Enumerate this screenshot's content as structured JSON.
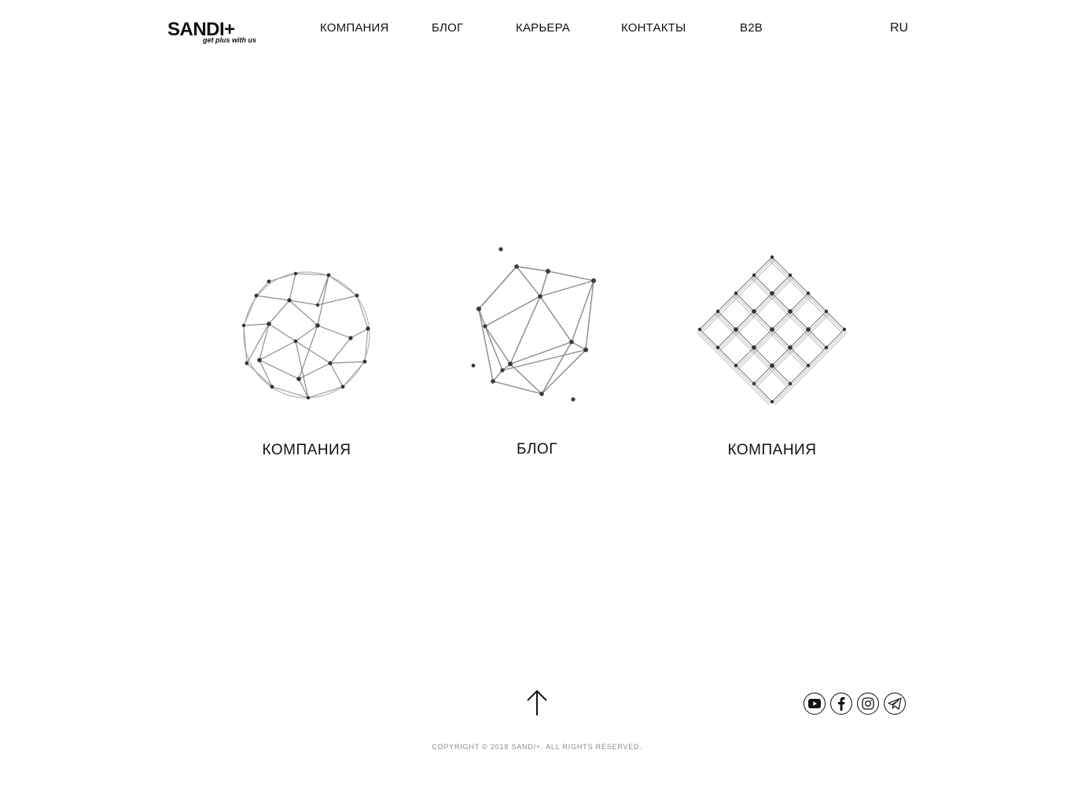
{
  "header": {
    "logo_text": "SANDI+",
    "logo_tagline": "get plus with us",
    "nav": [
      {
        "label": "КОМПАНИЯ"
      },
      {
        "label": "БЛОГ"
      },
      {
        "label": "КАРЬЕРА"
      },
      {
        "label": "КОНТАКТЫ"
      },
      {
        "label": "B2B"
      }
    ],
    "language": "RU"
  },
  "cards": [
    {
      "label": "КОМПАНИЯ",
      "icon": "geodesic-sphere-icon"
    },
    {
      "label": "БЛОГ",
      "icon": "polyhedron-icon"
    },
    {
      "label": "КОМПАНИЯ",
      "icon": "diamond-grid-icon"
    }
  ],
  "footer": {
    "scroll_top_icon": "arrow-up-icon",
    "socials": [
      "youtube-icon",
      "facebook-icon",
      "instagram-icon",
      "telegram-icon"
    ],
    "copyright": "COPYRIGHT © 2018 SANDI+. ALL RIGHTS RESERVED."
  },
  "colors": {
    "text": "#111111",
    "muted": "#8a8a8a",
    "background": "#ffffff"
  }
}
